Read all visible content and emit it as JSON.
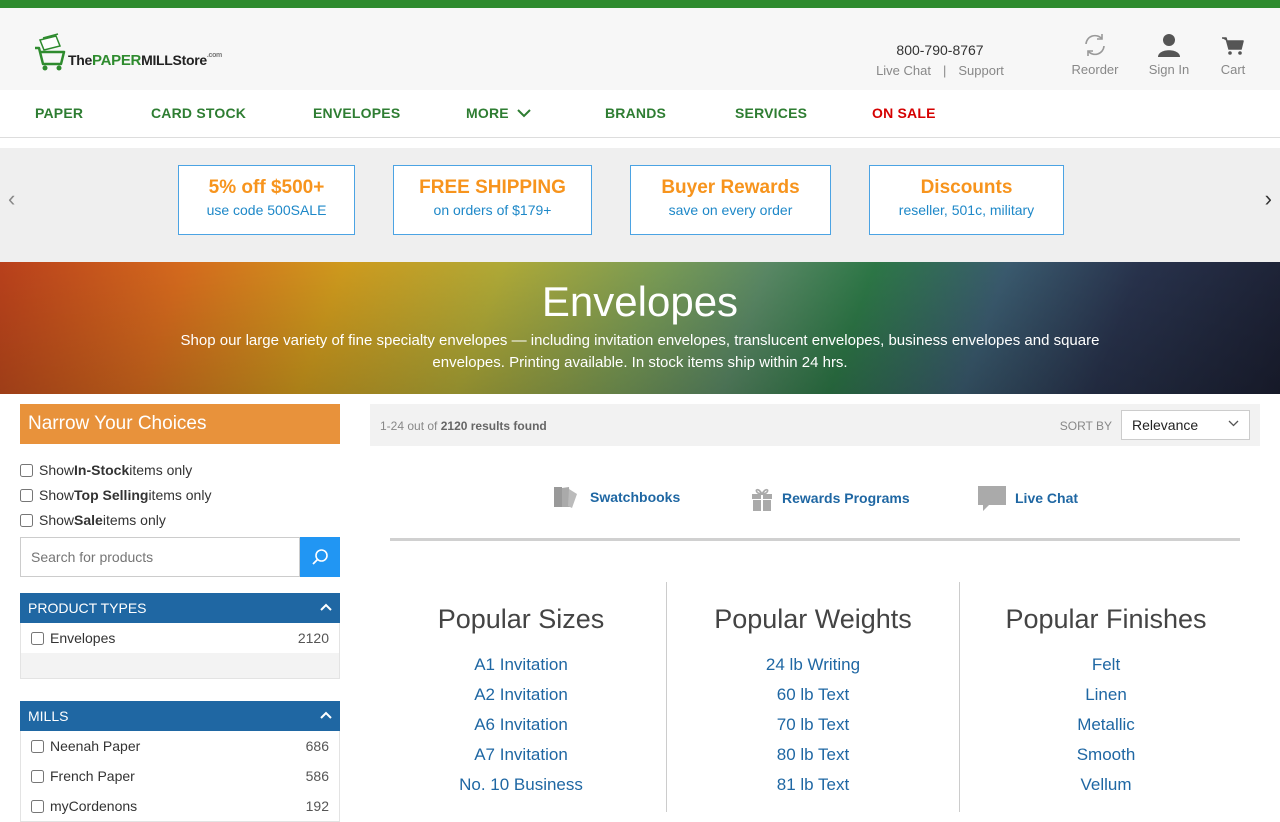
{
  "header": {
    "logo_text_the": "The",
    "logo_text_paper": "PAPER",
    "logo_text_mill": "MILL",
    "logo_text_store": "Store",
    "logo_text_com": ".com",
    "phone": "800-790-8767",
    "live_chat": "Live Chat",
    "support": "Support",
    "reorder": "Reorder",
    "sign_in": "Sign In",
    "cart": "Cart"
  },
  "nav": {
    "paper": "PAPER",
    "card_stock": "CARD STOCK",
    "envelopes": "ENVELOPES",
    "more": "MORE",
    "brands": "BRANDS",
    "services": "SERVICES",
    "on_sale": "ON SALE"
  },
  "promos": [
    {
      "title": "5% off $500+",
      "sub": "use code 500SALE"
    },
    {
      "title": "FREE SHIPPING",
      "sub": "on orders of $179+"
    },
    {
      "title": "Buyer Rewards",
      "sub": "save on every order"
    },
    {
      "title": "Discounts",
      "sub": "reseller, 501c, military"
    }
  ],
  "hero": {
    "title": "Envelopes",
    "desc": "Shop our large variety of fine specialty envelopes — including invitation envelopes, translucent envelopes, business envelopes and square envelopes. Printing available. In stock items ship within 24 hrs."
  },
  "sidebar": {
    "narrow_title": "Narrow Your Choices",
    "filters": [
      {
        "pre": "Show ",
        "bold": "In-Stock",
        "post": " items only"
      },
      {
        "pre": "Show ",
        "bold": "Top Selling",
        "post": " items only"
      },
      {
        "pre": "Show ",
        "bold": "Sale",
        "post": " items only"
      }
    ],
    "search_placeholder": "Search for products",
    "product_types_title": "PRODUCT TYPES",
    "product_types": [
      {
        "label": "Envelopes",
        "count": "2120"
      }
    ],
    "mills_title": "MILLS",
    "mills": [
      {
        "label": "Neenah Paper",
        "count": "686"
      },
      {
        "label": "French Paper",
        "count": "586"
      },
      {
        "label": "myCordenons",
        "count": "192"
      }
    ]
  },
  "results": {
    "range": "1-24 out of ",
    "count": "2120 results found",
    "sort_by": "SORT BY",
    "sort_value": "Relevance"
  },
  "quick_links": {
    "swatchbooks": "Swatchbooks",
    "rewards": "Rewards Programs",
    "live_chat": "Live Chat"
  },
  "popular": {
    "sizes_title": "Popular Sizes",
    "sizes": [
      "A1 Invitation",
      "A2 Invitation",
      "A6 Invitation",
      "A7 Invitation",
      "No. 10 Business"
    ],
    "weights_title": "Popular Weights",
    "weights": [
      "24 lb Writing",
      "60 lb Text",
      "70 lb Text",
      "80 lb Text",
      "81 lb Text"
    ],
    "finishes_title": "Popular Finishes",
    "finishes": [
      "Felt",
      "Linen",
      "Metallic",
      "Smooth",
      "Vellum"
    ]
  },
  "colors": {
    "brand_green": "#2e8b2e",
    "sale_red": "#d50000",
    "promo_orange": "#f7941d",
    "link_blue": "#1f67a3",
    "facet_header": "#1f67a3",
    "narrow_orange": "#e8923b"
  }
}
